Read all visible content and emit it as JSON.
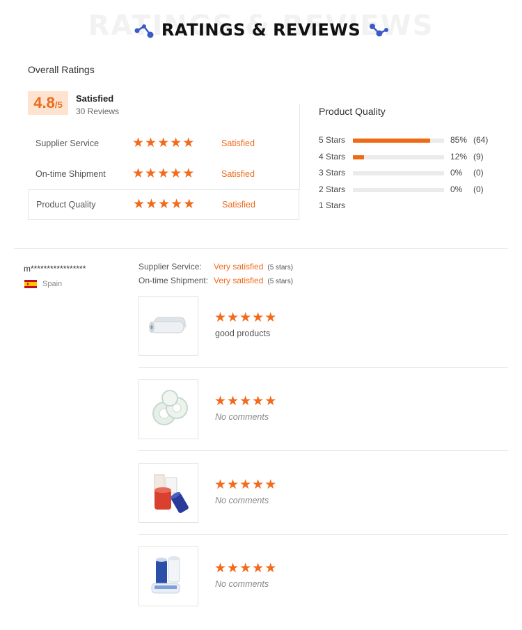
{
  "header": {
    "ghost_text": "RATINGS & REVIEWS",
    "title": "RATINGS & REVIEWS",
    "accent_color": "#3a5bc7"
  },
  "overall": {
    "title": "Overall Ratings",
    "score": "4.8",
    "score_den": "/5",
    "label": "Satisfied",
    "reviews": "30 Reviews",
    "rows": [
      {
        "label": "Supplier Service",
        "stars": 5,
        "value": "Satisfied"
      },
      {
        "label": "On-time Shipment",
        "stars": 5,
        "value": "Satisfied"
      },
      {
        "label": "Product Quality",
        "stars": 5,
        "value": "Satisfied"
      }
    ]
  },
  "product_quality": {
    "title": "Product Quality",
    "distribution": [
      {
        "label": "5  Stars",
        "percent": 85,
        "pct_text": "85%",
        "count": "(64)"
      },
      {
        "label": "4  Stars",
        "percent": 12,
        "pct_text": "12%",
        "count": "(9)"
      },
      {
        "label": "3  Stars",
        "percent": 0,
        "pct_text": "0%",
        "count": "(0)"
      },
      {
        "label": "2  Stars",
        "percent": 0,
        "pct_text": "0%",
        "count": "(0)"
      },
      {
        "label": "1  Stars",
        "percent": null,
        "pct_text": "",
        "count": ""
      }
    ]
  },
  "review": {
    "user": "m*****************",
    "country": "Spain",
    "supplier_service_label": "Supplier Service:",
    "supplier_service_value": "Very satisfied",
    "supplier_service_stars": "(5 stars)",
    "shipment_label": "On-time Shipment:",
    "shipment_value": "Very satisfied",
    "shipment_stars": "(5 stars)",
    "products": [
      {
        "stars": 5,
        "comment": "good products",
        "image": "clear-stretch-film-rolls"
      },
      {
        "stars": 5,
        "comment": "No comments",
        "image": "transparent-film-rolls"
      },
      {
        "stars": 5,
        "comment": "No comments",
        "image": "red-and-blue-protective-film-rolls"
      },
      {
        "stars": 5,
        "comment": "No comments",
        "image": "blue-and-white-tape-rolls"
      }
    ]
  },
  "colors": {
    "accent": "#ee6a1c",
    "score_bg": "#fde3d0",
    "bar_track": "#ebebeb"
  }
}
